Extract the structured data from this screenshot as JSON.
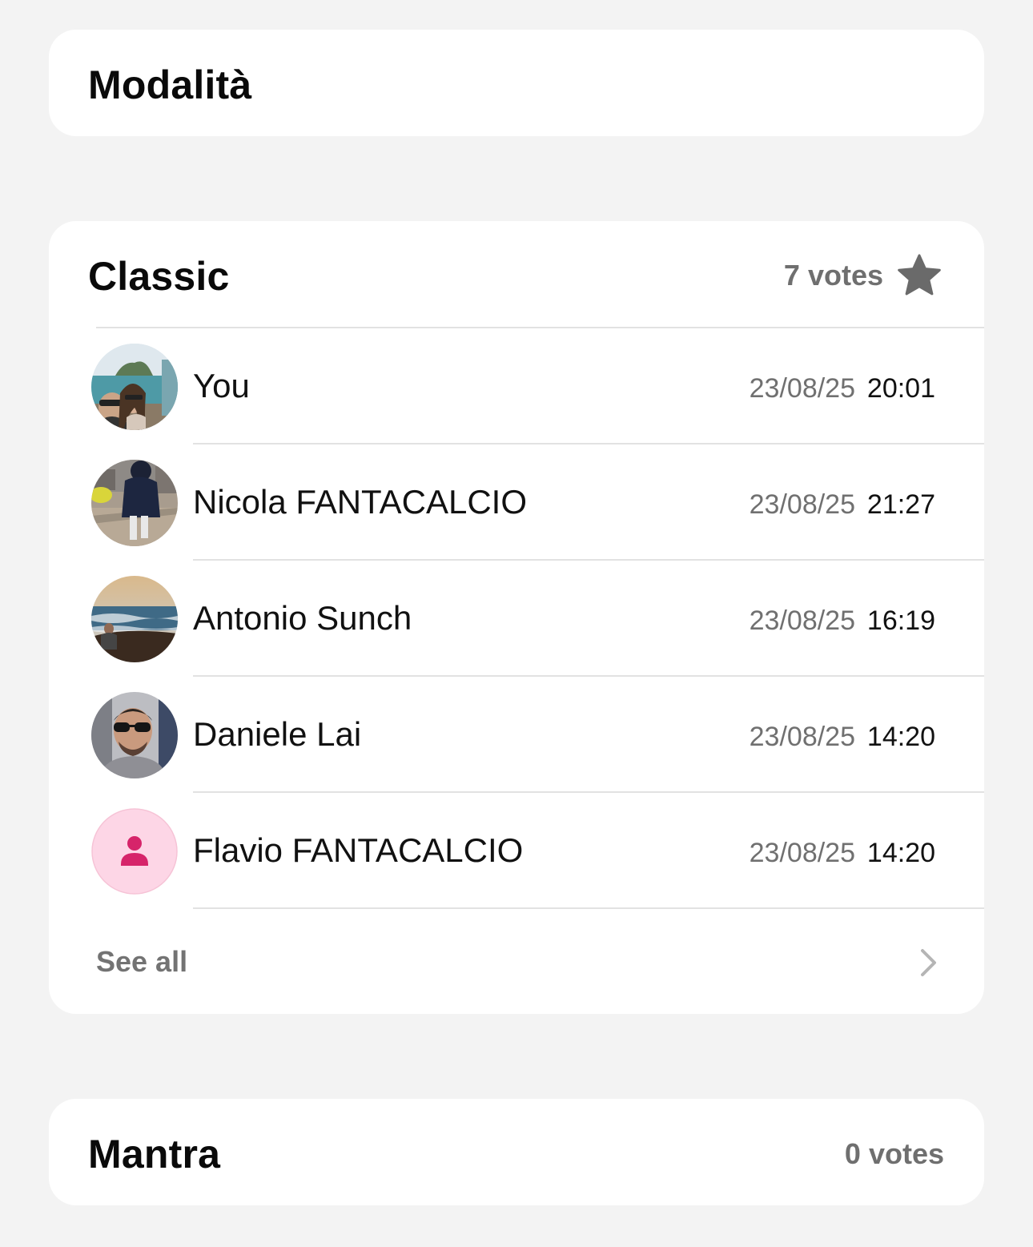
{
  "sections": {
    "modalita": {
      "title": "Modalità"
    },
    "classic": {
      "title": "Classic",
      "votes_label": "7 votes",
      "voters": [
        {
          "name": "You",
          "date": "23/08/25",
          "time": "20:01",
          "avatar": "photo-couple-seaside"
        },
        {
          "name": "Nicola FANTACALCIO",
          "date": "23/08/25",
          "time": "21:27",
          "avatar": "photo-street-person"
        },
        {
          "name": "Antonio Sunch",
          "date": "23/08/25",
          "time": "16:19",
          "avatar": "photo-sea-sunset"
        },
        {
          "name": "Daniele Lai",
          "date": "23/08/25",
          "time": "14:20",
          "avatar": "photo-selfie-sunglasses"
        },
        {
          "name": "Flavio FANTACALCIO",
          "date": "23/08/25",
          "time": "14:20",
          "avatar": "default-person-icon"
        }
      ],
      "see_all_label": "See all"
    },
    "mantra": {
      "title": "Mantra",
      "votes_label": "0 votes"
    }
  },
  "colors": {
    "background": "#f3f3f3",
    "card": "#ffffff",
    "muted_text": "#707070",
    "divider": "#e2e2e2",
    "default_avatar_bg": "#fdd6e6",
    "default_avatar_fg": "#d6246a"
  }
}
